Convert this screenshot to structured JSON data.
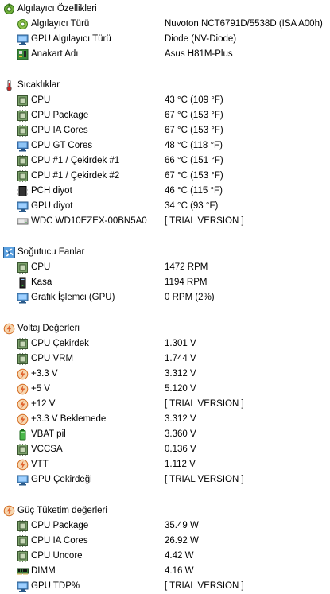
{
  "sections": [
    {
      "title": "Algılayıcı Özellikleri",
      "icon": "sensor-properties-icon",
      "rows": [
        {
          "label": "Algılayıcı Türü",
          "value": "Nuvoton NCT6791D/5538D  (ISA A00h)",
          "icon": "sensor-icon"
        },
        {
          "label": "GPU Algılayıcı Türü",
          "value": "Diode  (NV-Diode)",
          "icon": "gpu-icon"
        },
        {
          "label": "Anakart Adı",
          "value": "Asus H81M-Plus",
          "icon": "motherboard-icon"
        }
      ]
    },
    {
      "title": "Sıcaklıklar",
      "icon": "thermometer-icon",
      "rows": [
        {
          "label": "CPU",
          "value": "43 °C  (109 °F)",
          "icon": "cpu-chip-icon"
        },
        {
          "label": "CPU Package",
          "value": "67 °C  (153 °F)",
          "icon": "cpu-chip-icon"
        },
        {
          "label": "CPU IA Cores",
          "value": "67 °C  (153 °F)",
          "icon": "cpu-chip-icon"
        },
        {
          "label": "CPU GT Cores",
          "value": "48 °C  (118 °F)",
          "icon": "monitor-icon"
        },
        {
          "label": "CPU #1 / Çekirdek #1",
          "value": "66 °C  (151 °F)",
          "icon": "cpu-chip-icon"
        },
        {
          "label": "CPU #1 / Çekirdek #2",
          "value": "67 °C  (153 °F)",
          "icon": "cpu-chip-icon"
        },
        {
          "label": "PCH diyot",
          "value": "46 °C  (115 °F)",
          "icon": "pch-chip-icon"
        },
        {
          "label": "GPU diyot",
          "value": "34 °C  (93 °F)",
          "icon": "gpu-icon"
        },
        {
          "label": "WDC WD10EZEX-00BN5A0",
          "value": "[ TRIAL VERSION ]",
          "icon": "hard-drive-icon"
        }
      ]
    },
    {
      "title": "Soğutucu Fanlar",
      "icon": "fan-icon",
      "rows": [
        {
          "label": "CPU",
          "value": "1472 RPM",
          "icon": "cpu-chip-icon"
        },
        {
          "label": "Kasa",
          "value": "1194 RPM",
          "icon": "computer-case-icon"
        },
        {
          "label": "Grafik İşlemci (GPU)",
          "value": "0 RPM  (2%)",
          "icon": "gpu-icon"
        }
      ]
    },
    {
      "title": "Voltaj Değerleri",
      "icon": "voltage-icon",
      "rows": [
        {
          "label": "CPU Çekirdek",
          "value": "1.301 V",
          "icon": "cpu-chip-icon"
        },
        {
          "label": "CPU VRM",
          "value": "1.744 V",
          "icon": "cpu-chip-icon"
        },
        {
          "label": "+3.3 V",
          "value": "3.312 V",
          "icon": "voltage-icon"
        },
        {
          "label": "+5 V",
          "value": "5.120 V",
          "icon": "voltage-icon"
        },
        {
          "label": "+12 V",
          "value": "[ TRIAL VERSION ]",
          "icon": "voltage-icon"
        },
        {
          "label": "+3.3 V Beklemede",
          "value": "3.312 V",
          "icon": "voltage-icon"
        },
        {
          "label": "VBAT pil",
          "value": "3.360 V",
          "icon": "battery-icon"
        },
        {
          "label": "VCCSA",
          "value": "0.136 V",
          "icon": "cpu-chip-icon"
        },
        {
          "label": "VTT",
          "value": "1.112 V",
          "icon": "voltage-icon"
        },
        {
          "label": "GPU Çekirdeği",
          "value": "[ TRIAL VERSION ]",
          "icon": "gpu-icon"
        }
      ]
    },
    {
      "title": "Güç Tüketim değerleri",
      "icon": "voltage-icon",
      "rows": [
        {
          "label": "CPU Package",
          "value": "35.49 W",
          "icon": "cpu-chip-icon"
        },
        {
          "label": "CPU IA Cores",
          "value": "26.92 W",
          "icon": "cpu-chip-icon"
        },
        {
          "label": "CPU Uncore",
          "value": "4.42 W",
          "icon": "cpu-chip-icon"
        },
        {
          "label": "DIMM",
          "value": "4.16 W",
          "icon": "memory-module-icon"
        },
        {
          "label": "GPU TDP%",
          "value": "[ TRIAL VERSION ]",
          "icon": "gpu-icon"
        }
      ]
    }
  ]
}
